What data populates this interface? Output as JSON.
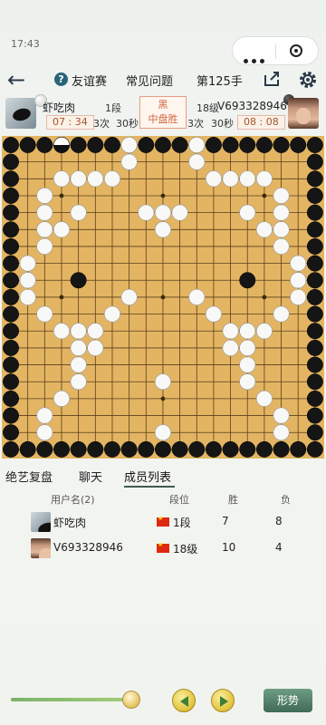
{
  "status": {
    "time": "17:43"
  },
  "nav": {
    "title": "友谊赛",
    "faq": "常见问题",
    "move": "第125手"
  },
  "players": {
    "left": {
      "name": "虾吃肉",
      "rank": "1段",
      "clock": "07 : 34",
      "periods": "3次",
      "period_time": "30秒",
      "stone": "white"
    },
    "right": {
      "name": "V693328946",
      "rank": "18级",
      "clock": "08 : 08",
      "periods": "3次",
      "period_time": "30秒",
      "stone": "black"
    },
    "result": {
      "line1": "黑",
      "line2": "中盘胜"
    }
  },
  "board": {
    "size": 19,
    "black": [
      [
        0,
        0
      ],
      [
        1,
        0
      ],
      [
        2,
        0
      ],
      [
        3,
        0
      ],
      [
        18,
        0
      ],
      [
        0,
        1
      ],
      [
        18,
        1
      ],
      [
        0,
        2
      ],
      [
        18,
        2
      ],
      [
        0,
        3
      ],
      [
        18,
        3
      ],
      [
        0,
        4
      ],
      [
        18,
        4
      ],
      [
        0,
        5
      ],
      [
        18,
        5
      ],
      [
        0,
        6
      ],
      [
        18,
        6
      ],
      [
        0,
        7
      ],
      [
        18,
        7
      ],
      [
        0,
        8
      ],
      [
        18,
        8
      ],
      [
        0,
        9
      ],
      [
        18,
        9
      ],
      [
        0,
        10
      ],
      [
        18,
        10
      ],
      [
        0,
        11
      ],
      [
        18,
        11
      ],
      [
        0,
        12
      ],
      [
        18,
        12
      ],
      [
        0,
        13
      ],
      [
        18,
        13
      ],
      [
        0,
        14
      ],
      [
        18,
        14
      ],
      [
        0,
        15
      ],
      [
        18,
        15
      ],
      [
        0,
        16
      ],
      [
        18,
        16
      ],
      [
        0,
        17
      ],
      [
        18,
        17
      ],
      [
        0,
        18
      ],
      [
        1,
        18
      ],
      [
        2,
        18
      ],
      [
        3,
        18
      ],
      [
        4,
        18
      ],
      [
        5,
        18
      ],
      [
        6,
        18
      ],
      [
        7,
        18
      ],
      [
        8,
        18
      ],
      [
        9,
        18
      ],
      [
        10,
        18
      ],
      [
        11,
        18
      ],
      [
        12,
        18
      ],
      [
        13,
        18
      ],
      [
        14,
        18
      ],
      [
        15,
        18
      ],
      [
        16,
        18
      ],
      [
        17,
        18
      ],
      [
        18,
        18
      ],
      [
        4,
        0
      ],
      [
        5,
        0
      ],
      [
        6,
        0
      ],
      [
        7,
        0
      ],
      [
        8,
        0
      ],
      [
        9,
        0
      ],
      [
        10,
        0
      ],
      [
        11,
        0
      ],
      [
        12,
        0
      ],
      [
        13,
        0
      ],
      [
        14,
        0
      ],
      [
        15,
        0
      ],
      [
        16,
        0
      ],
      [
        17,
        0
      ],
      [
        4,
        8
      ],
      [
        14,
        8
      ]
    ],
    "white": [
      [
        7,
        0
      ],
      [
        11,
        0
      ],
      [
        7,
        1
      ],
      [
        11,
        1
      ],
      [
        3,
        2
      ],
      [
        4,
        2
      ],
      [
        5,
        2
      ],
      [
        6,
        2
      ],
      [
        12,
        2
      ],
      [
        13,
        2
      ],
      [
        14,
        2
      ],
      [
        15,
        2
      ],
      [
        2,
        3
      ],
      [
        16,
        3
      ],
      [
        2,
        4
      ],
      [
        4,
        4
      ],
      [
        8,
        4
      ],
      [
        9,
        4
      ],
      [
        10,
        4
      ],
      [
        14,
        4
      ],
      [
        16,
        4
      ],
      [
        2,
        5
      ],
      [
        3,
        5
      ],
      [
        9,
        5
      ],
      [
        15,
        5
      ],
      [
        16,
        5
      ],
      [
        2,
        6
      ],
      [
        16,
        6
      ],
      [
        1,
        7
      ],
      [
        17,
        7
      ],
      [
        1,
        8
      ],
      [
        17,
        8
      ],
      [
        1,
        9
      ],
      [
        7,
        9
      ],
      [
        11,
        9
      ],
      [
        17,
        9
      ],
      [
        2,
        10
      ],
      [
        6,
        10
      ],
      [
        12,
        10
      ],
      [
        16,
        10
      ],
      [
        3,
        11
      ],
      [
        4,
        11
      ],
      [
        5,
        11
      ],
      [
        13,
        11
      ],
      [
        14,
        11
      ],
      [
        15,
        11
      ],
      [
        4,
        12
      ],
      [
        5,
        12
      ],
      [
        13,
        12
      ],
      [
        14,
        12
      ],
      [
        4,
        13
      ],
      [
        14,
        13
      ],
      [
        4,
        14
      ],
      [
        9,
        14
      ],
      [
        14,
        14
      ],
      [
        3,
        15
      ],
      [
        15,
        15
      ],
      [
        2,
        16
      ],
      [
        16,
        16
      ],
      [
        2,
        17
      ],
      [
        9,
        17
      ],
      [
        16,
        17
      ]
    ],
    "last_move": [
      3,
      0
    ]
  },
  "tabs": {
    "review": "绝艺复盘",
    "chat": "聊天",
    "members": "成员列表"
  },
  "table": {
    "headers": {
      "user": "用户名(2)",
      "rank": "段位",
      "win": "胜",
      "loss": "负"
    },
    "rows": [
      {
        "name": "虾吃肉",
        "rank": "1段",
        "wins": "7",
        "losses": "8"
      },
      {
        "name": "V693328946",
        "rank": "18级",
        "wins": "10",
        "losses": "4"
      }
    ]
  },
  "controls": {
    "shape_label": "形势",
    "progress": 0.94
  },
  "colors": {
    "accent": "#3d5a4f",
    "clock_text": "#a4552f",
    "result": "#d0653f",
    "board": "#e3b563"
  }
}
